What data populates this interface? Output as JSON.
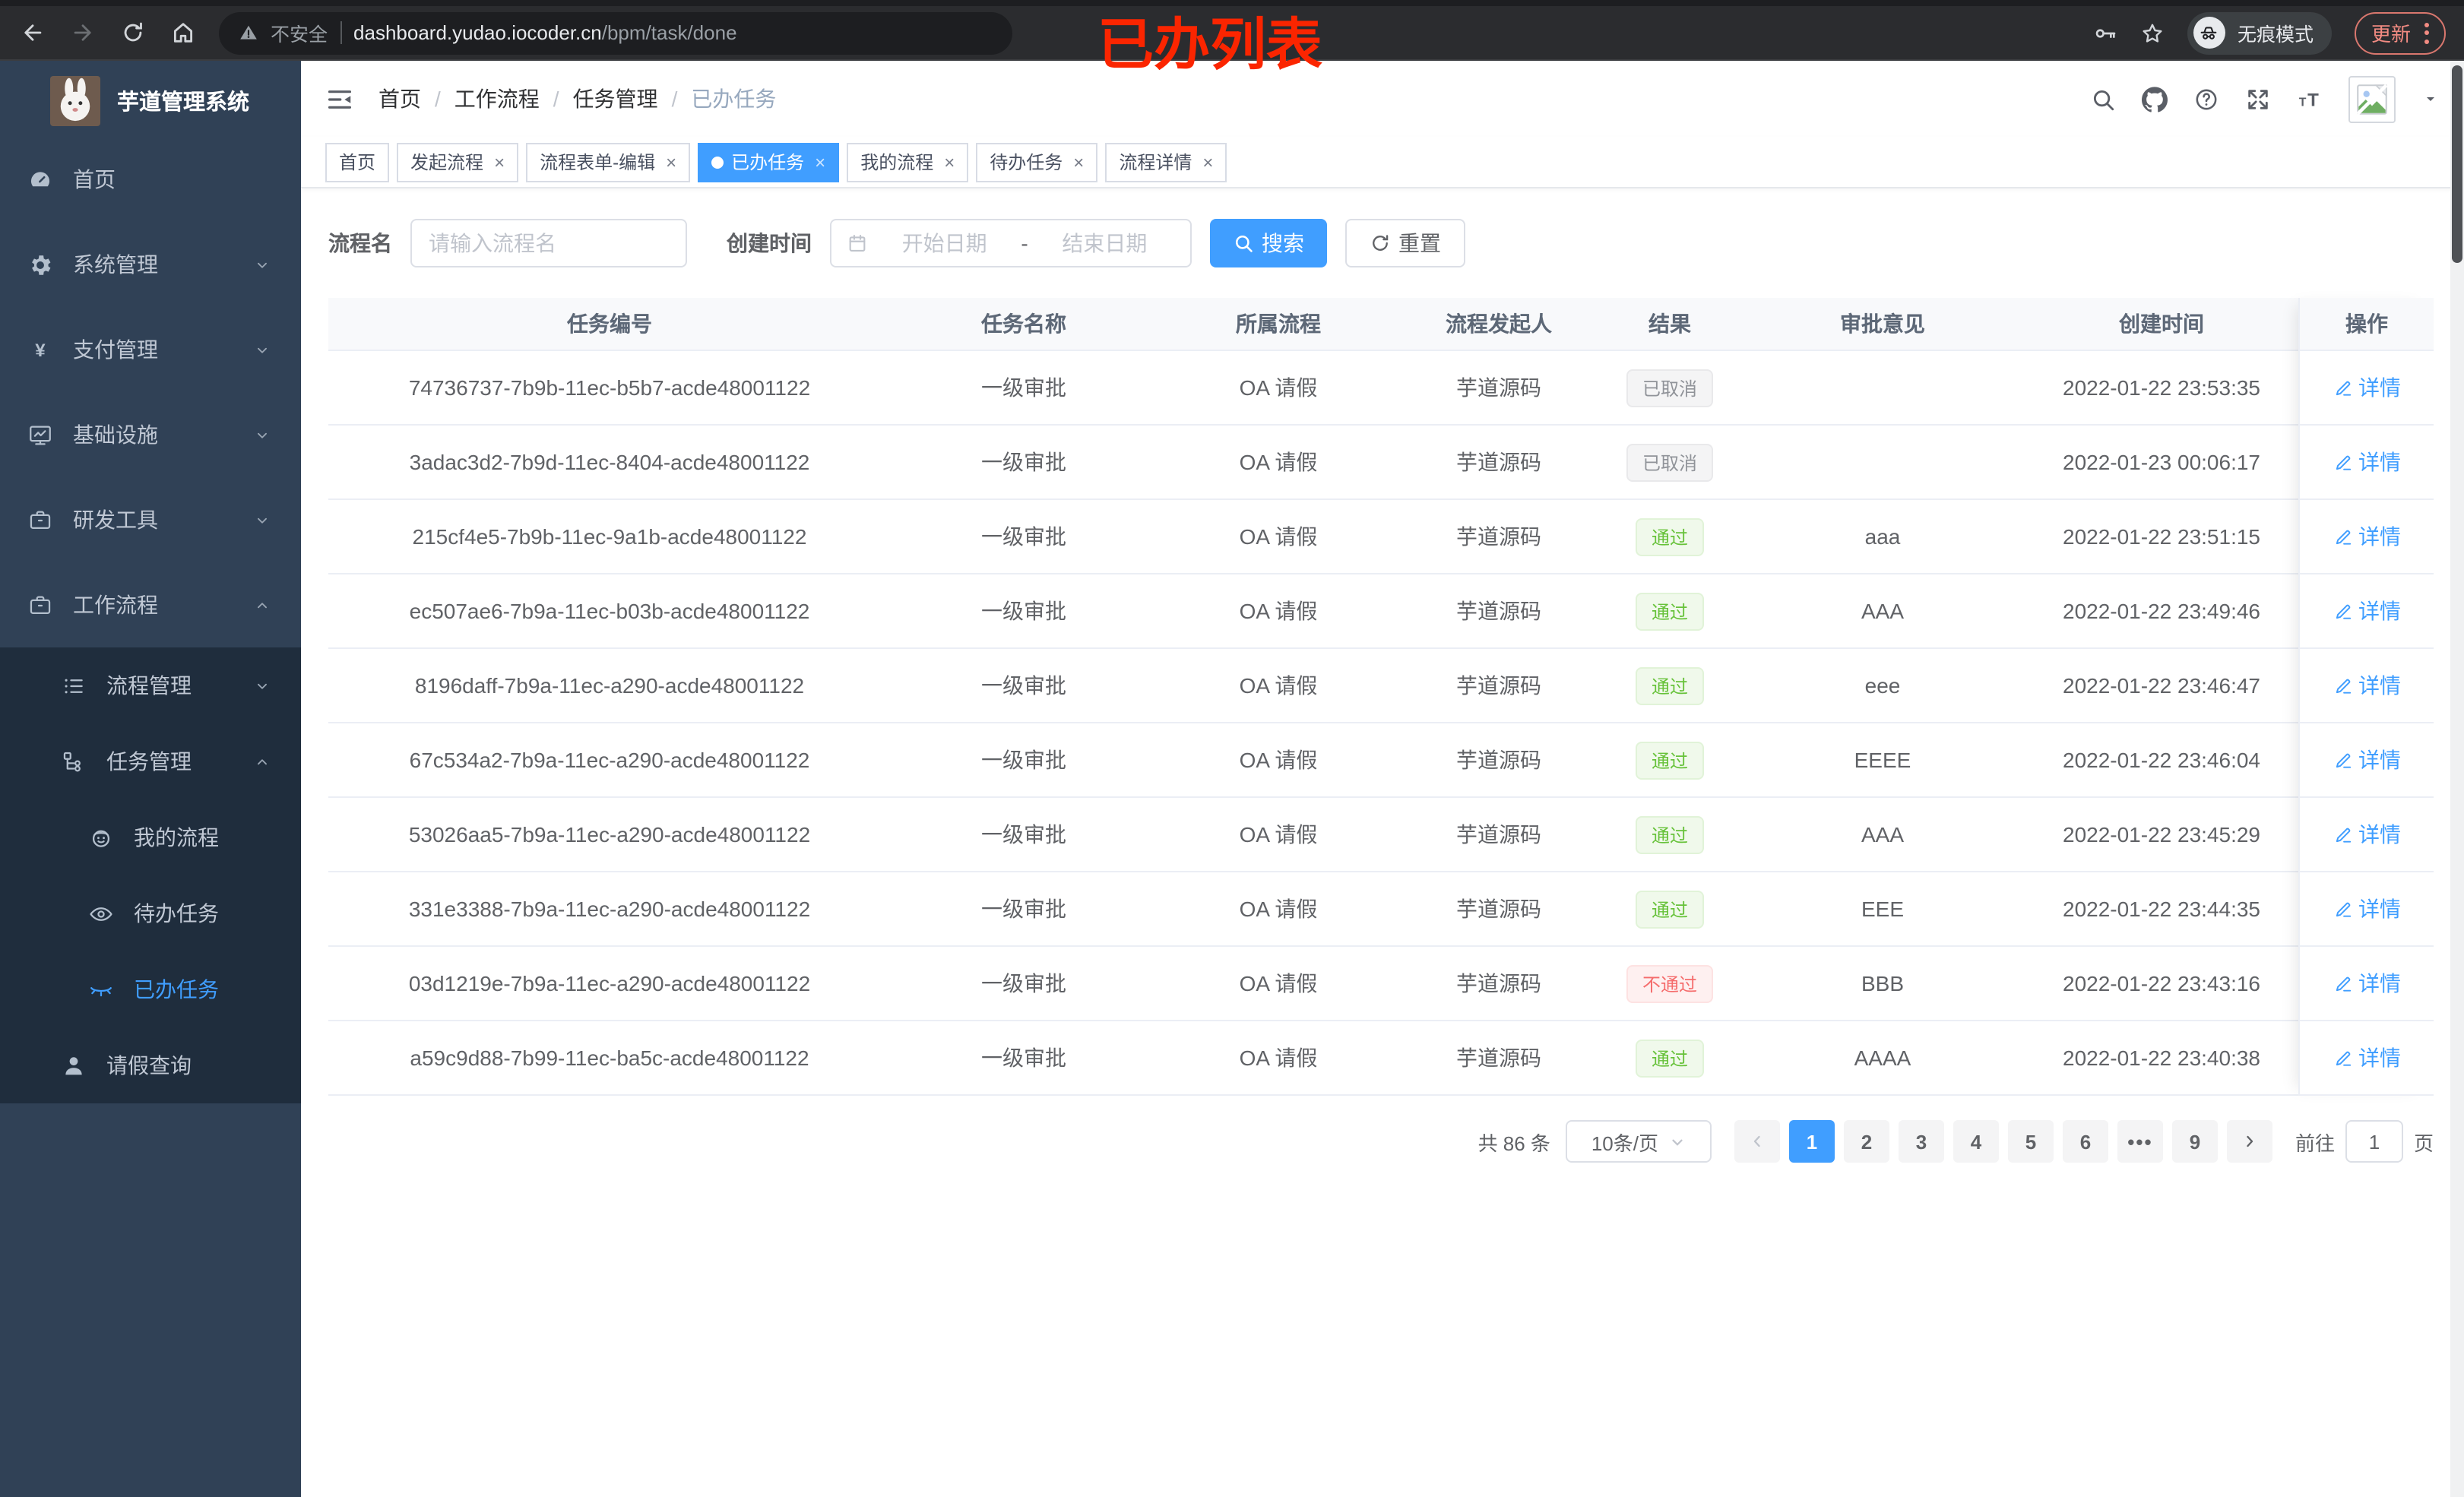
{
  "colors": {
    "accent": "#409eff",
    "success": "#67c23a",
    "danger": "#f56c6c",
    "info": "#909399",
    "sidebar": "#304156",
    "submenu": "#1f2d3d",
    "anno": "#fb2500",
    "update": "#f28b82"
  },
  "browser": {
    "security_label": "不安全",
    "url_host": "dashboard.yudao.iocoder.cn",
    "url_path": "/bpm/task/done",
    "incognito_label": "无痕模式",
    "update_label": "更新"
  },
  "annotation": {
    "text": "已办列表"
  },
  "sidebar": {
    "logo_title": "芋道管理系统",
    "menu": [
      {
        "key": "home",
        "label": "首页",
        "icon": "dashboard-icon",
        "level": 1
      },
      {
        "key": "system",
        "label": "系统管理",
        "icon": "gear-icon",
        "level": 1,
        "chevron": "down"
      },
      {
        "key": "payment",
        "label": "支付管理",
        "icon": "yen-icon",
        "level": 1,
        "chevron": "down"
      },
      {
        "key": "infrastructure",
        "label": "基础设施",
        "icon": "monitor-icon",
        "level": 1,
        "chevron": "down"
      },
      {
        "key": "dev-tools",
        "label": "研发工具",
        "icon": "briefcase-icon",
        "level": 1,
        "chevron": "down"
      },
      {
        "key": "workflow",
        "label": "工作流程",
        "icon": "briefcase-icon",
        "level": 1,
        "chevron": "up"
      },
      {
        "key": "process-management",
        "label": "流程管理",
        "icon": "list-icon",
        "level": 2,
        "chevron": "down",
        "sub": true
      },
      {
        "key": "task-management",
        "label": "任务管理",
        "icon": "tree-icon",
        "level": 2,
        "chevron": "up",
        "sub": true
      },
      {
        "key": "my-process",
        "label": "我的流程",
        "icon": "robot-icon",
        "level": 3,
        "sub": true
      },
      {
        "key": "todo-tasks",
        "label": "待办任务",
        "icon": "eye-icon",
        "level": 3,
        "sub": true
      },
      {
        "key": "done-tasks",
        "label": "已办任务",
        "icon": "eye-closed-icon",
        "level": 3,
        "sub": true,
        "active": true
      },
      {
        "key": "leave-query",
        "label": "请假查询",
        "icon": "user-icon",
        "level": 2,
        "sub": true
      }
    ]
  },
  "header": {
    "breadcrumb": [
      "首页",
      "工作流程",
      "任务管理",
      "已办任务"
    ]
  },
  "tabs": [
    {
      "key": "home",
      "label": "首页",
      "closable": false
    },
    {
      "key": "start-process",
      "label": "发起流程",
      "closable": true
    },
    {
      "key": "process-form-edit",
      "label": "流程表单-编辑",
      "closable": true
    },
    {
      "key": "done-tasks",
      "label": "已办任务",
      "closable": true,
      "active": true
    },
    {
      "key": "my-process",
      "label": "我的流程",
      "closable": true
    },
    {
      "key": "todo-tasks",
      "label": "待办任务",
      "closable": true
    },
    {
      "key": "process-detail",
      "label": "流程详情",
      "closable": true
    }
  ],
  "filters": {
    "name_label": "流程名",
    "name_placeholder": "请输入流程名",
    "time_label": "创建时间",
    "start_placeholder": "开始日期",
    "range_separator": "-",
    "end_placeholder": "结束日期",
    "search_label": "搜索",
    "reset_label": "重置"
  },
  "table": {
    "columns": [
      "任务编号",
      "任务名称",
      "所属流程",
      "流程发起人",
      "结果",
      "审批意见",
      "创建时间",
      "操作"
    ],
    "detail_label": "详情",
    "rows": [
      {
        "id": "74736737-7b9b-11ec-b5b7-acde48001122",
        "name": "一级审批",
        "process": "OA 请假",
        "starter": "芋道源码",
        "result": "已取消",
        "result_type": "info",
        "comment": "",
        "time": "2022-01-22 23:53:35"
      },
      {
        "id": "3adac3d2-7b9d-11ec-8404-acde48001122",
        "name": "一级审批",
        "process": "OA 请假",
        "starter": "芋道源码",
        "result": "已取消",
        "result_type": "info",
        "comment": "",
        "time": "2022-01-23 00:06:17"
      },
      {
        "id": "215cf4e5-7b9b-11ec-9a1b-acde48001122",
        "name": "一级审批",
        "process": "OA 请假",
        "starter": "芋道源码",
        "result": "通过",
        "result_type": "success",
        "comment": "aaa",
        "time": "2022-01-22 23:51:15"
      },
      {
        "id": "ec507ae6-7b9a-11ec-b03b-acde48001122",
        "name": "一级审批",
        "process": "OA 请假",
        "starter": "芋道源码",
        "result": "通过",
        "result_type": "success",
        "comment": "AAA",
        "time": "2022-01-22 23:49:46"
      },
      {
        "id": "8196daff-7b9a-11ec-a290-acde48001122",
        "name": "一级审批",
        "process": "OA 请假",
        "starter": "芋道源码",
        "result": "通过",
        "result_type": "success",
        "comment": "eee",
        "time": "2022-01-22 23:46:47"
      },
      {
        "id": "67c534a2-7b9a-11ec-a290-acde48001122",
        "name": "一级审批",
        "process": "OA 请假",
        "starter": "芋道源码",
        "result": "通过",
        "result_type": "success",
        "comment": "EEEE",
        "time": "2022-01-22 23:46:04"
      },
      {
        "id": "53026aa5-7b9a-11ec-a290-acde48001122",
        "name": "一级审批",
        "process": "OA 请假",
        "starter": "芋道源码",
        "result": "通过",
        "result_type": "success",
        "comment": "AAA",
        "time": "2022-01-22 23:45:29"
      },
      {
        "id": "331e3388-7b9a-11ec-a290-acde48001122",
        "name": "一级审批",
        "process": "OA 请假",
        "starter": "芋道源码",
        "result": "通过",
        "result_type": "success",
        "comment": "EEE",
        "time": "2022-01-22 23:44:35"
      },
      {
        "id": "03d1219e-7b9a-11ec-a290-acde48001122",
        "name": "一级审批",
        "process": "OA 请假",
        "starter": "芋道源码",
        "result": "不通过",
        "result_type": "danger",
        "comment": "BBB",
        "time": "2022-01-22 23:43:16"
      },
      {
        "id": "a59c9d88-7b99-11ec-ba5c-acde48001122",
        "name": "一级审批",
        "process": "OA 请假",
        "starter": "芋道源码",
        "result": "通过",
        "result_type": "success",
        "comment": "AAAA",
        "time": "2022-01-22 23:40:38"
      }
    ]
  },
  "pagination": {
    "total_label": "共 86 条",
    "page_size_label": "10条/页",
    "pages": [
      "1",
      "2",
      "3",
      "4",
      "5",
      "6",
      "...",
      "9"
    ],
    "active_page": "1",
    "prev_disabled": true,
    "goto_label": "前往",
    "goto_value": "1",
    "unit_label": "页"
  }
}
